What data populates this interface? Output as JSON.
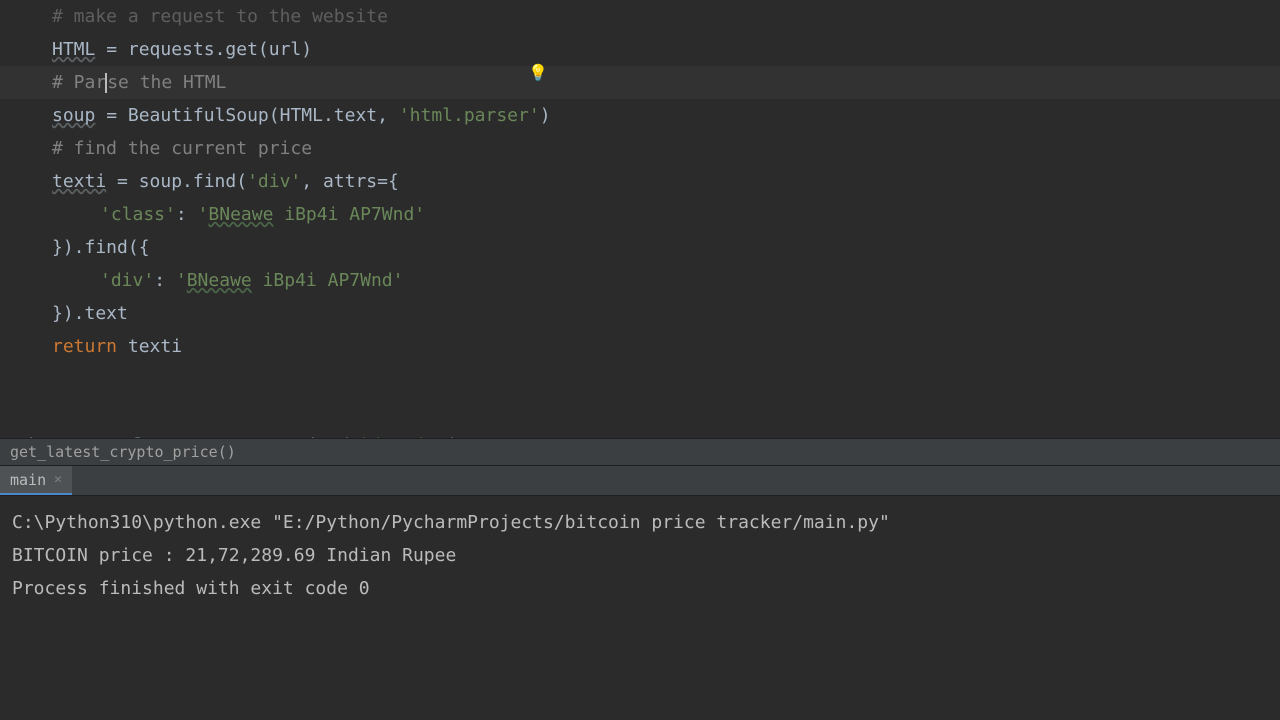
{
  "code": {
    "l1": "# make a request to the website",
    "l2_var": "HTML",
    "l2_rest": " = requests.get(url)",
    "l3_pre": "# Par",
    "l3_post": "se the HTML",
    "l4_var": "soup",
    "l4_eq": " = ",
    "l4_fn": "BeautifulSoup",
    "l4_p1": "(HTML.text, ",
    "l4_str": "'html.parser'",
    "l4_p2": ")",
    "l5": "# find the current price",
    "l6_var": "texti",
    "l6_rest": " = soup.find(",
    "l6_str": "'div'",
    "l6_c": ", ",
    "l6_kw": "attrs",
    "l6_eq": "={",
    "l7_k": "'class'",
    "l7_c": ": ",
    "l7_v1": "'",
    "l7_v2": "BNeawe",
    "l7_v3": " iBp4i AP7Wnd'",
    "l8": "}).find({",
    "l9_k": "'div'",
    "l9_c": ": ",
    "l9_v1": "'",
    "l9_v2": "BNeawe",
    "l9_v3": " iBp4i AP7Wnd'",
    "l10": "}).text",
    "l11_kw": "return",
    "l11_rest": " texti",
    "l12_pre": "price = get_latest_crypto_price(",
    "l12_str": "'bitcoin'",
    "l12_post": ")"
  },
  "breadcrumb": {
    "text": "get_latest_crypto_price()"
  },
  "tab": {
    "label": "main",
    "close": "✕"
  },
  "console": {
    "l1": "C:\\Python310\\python.exe \"E:/Python/PycharmProjects/bitcoin price tracker/main.py\"",
    "l2": "BITCOIN price : 21,72,289.69 Indian Rupee",
    "l3": "",
    "l4": "Process finished with exit code 0"
  },
  "bulb_icon": "💡"
}
